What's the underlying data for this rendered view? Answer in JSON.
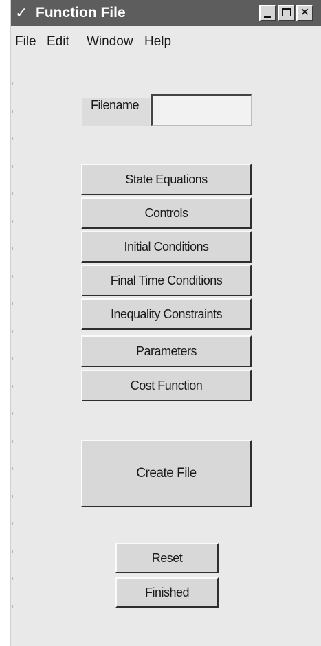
{
  "window": {
    "title": "Function File",
    "title_icon": "checkmark-icon"
  },
  "menu": [
    {
      "label": "File"
    },
    {
      "label": "Edit"
    },
    {
      "label": "Window"
    },
    {
      "label": "Help"
    }
  ],
  "filename": {
    "label": "Filename",
    "value": ""
  },
  "buttons": {
    "state_equations": "State Equations",
    "controls": "Controls",
    "initial_conditions": "Initial Conditions",
    "final_time_conditions": "Final Time Conditions",
    "inequality_constraints": "Inequality Constraints",
    "parameters": "Parameters",
    "cost_function": "Cost Function",
    "create_file": "Create File",
    "reset": "Reset",
    "finished": "Finished"
  },
  "colors": {
    "titlebar": "#5d5d5d",
    "window_bg": "#e9e9e9",
    "button_face": "#d8d8d8"
  }
}
